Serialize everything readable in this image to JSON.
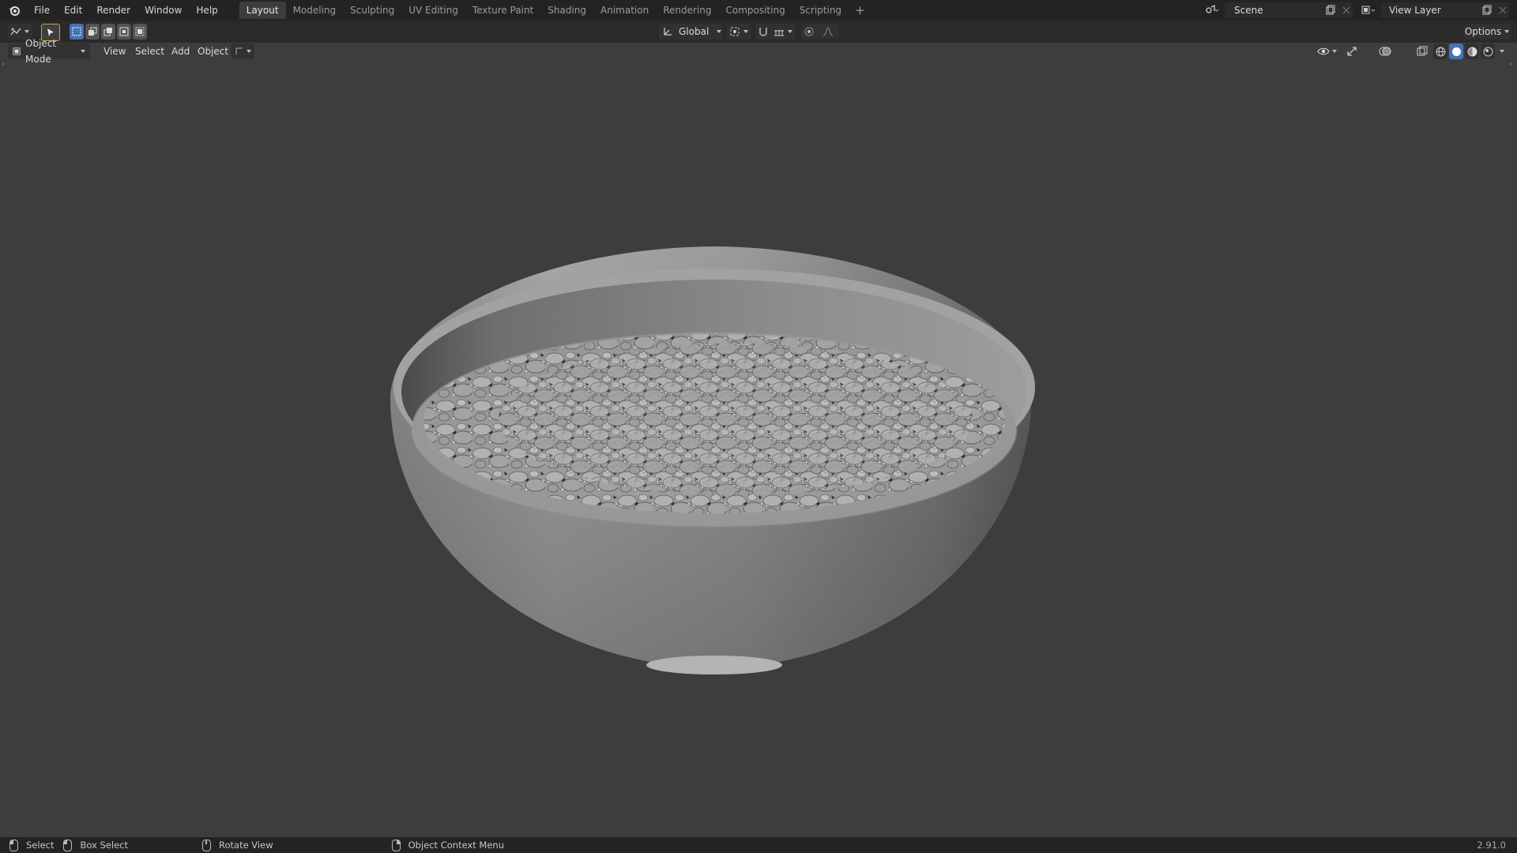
{
  "menu": {
    "items": [
      "File",
      "Edit",
      "Render",
      "Window",
      "Help"
    ]
  },
  "workspaces": {
    "tabs": [
      "Layout",
      "Modeling",
      "Sculpting",
      "UV Editing",
      "Texture Paint",
      "Shading",
      "Animation",
      "Rendering",
      "Compositing",
      "Scripting"
    ],
    "active": "Layout",
    "add_label": "+"
  },
  "scene": {
    "name": "Scene",
    "view_layer": "View Layer"
  },
  "tool_header": {
    "transform_orientation": "Global",
    "options_label": "Options"
  },
  "viewport_header": {
    "mode": "Object Mode",
    "menus": [
      "View",
      "Select",
      "Add",
      "Object"
    ]
  },
  "status_bar": {
    "select": "Select",
    "box_select": "Box Select",
    "rotate_view": "Rotate View",
    "context_menu": "Object Context Menu",
    "version": "2.91.0"
  },
  "colors": {
    "accent": "#4772b3",
    "background": "#3d3d3d",
    "topbar": "#232323",
    "header": "#2a2a2a"
  }
}
